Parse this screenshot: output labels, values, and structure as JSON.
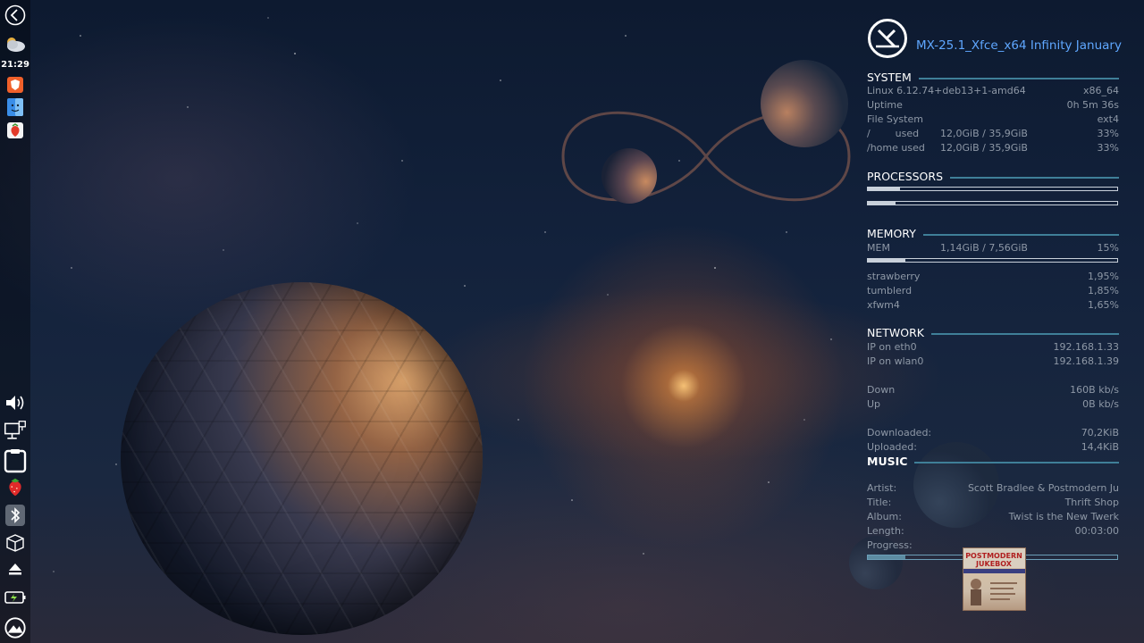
{
  "panel": {
    "clock": "21:29"
  },
  "conky": {
    "title": "MX-25.1_Xfce_x64 Infinity January",
    "system": {
      "title": "SYSTEM",
      "kernel": "Linux 6.12.74+deb13+1-amd64",
      "arch": "x86_64",
      "uptime_label": "Uptime",
      "uptime_value": "0h 5m 36s",
      "fs_label": "File System",
      "fs_value": "ext4",
      "root_label": "/        used",
      "root_size": "12,0GiB / 35,9GiB",
      "root_pct": "33%",
      "home_label": "/home used",
      "home_size": "12,0GiB / 35,9GiB",
      "home_pct": "33%"
    },
    "processors": {
      "title": "PROCESSORS",
      "cpu1_fraction": 0.13,
      "cpu2_fraction": 0.11
    },
    "memory": {
      "title": "MEMORY",
      "mem_label": "MEM",
      "mem_value": "1,14GiB / 7,56GiB",
      "mem_pct": "15%",
      "mem_fraction": 0.15,
      "processes": [
        {
          "name": "strawberry",
          "value": "1,95%"
        },
        {
          "name": "tumblerd",
          "value": "1,85%"
        },
        {
          "name": "xfwm4",
          "value": "1,65%"
        }
      ]
    },
    "network": {
      "title": "NETWORK",
      "eth_label": "IP on eth0",
      "eth_value": "192.168.1.33",
      "wlan_label": "IP on wlan0",
      "wlan_value": "192.168.1.39",
      "down_label": "Down",
      "down_value": "160B kb/s",
      "up_label": "Up",
      "up_value": "0B kb/s",
      "downloaded_label": "Downloaded:",
      "downloaded_value": "70,2KiB",
      "uploaded_label": "Uploaded:",
      "uploaded_value": "14,4KiB"
    },
    "music": {
      "title": "MUSIC",
      "artist_label": "Artist:",
      "artist_value": "Scott Bradlee & Postmodern Ju",
      "title_label": "Title:",
      "title_value": "Thrift Shop",
      "album_label": "Album:",
      "album_value": "Twist is the New Twerk",
      "length_label": "Length:",
      "length_value": "00:03:00",
      "progress_label": "Progress:",
      "progress_fraction": 0.15
    }
  }
}
